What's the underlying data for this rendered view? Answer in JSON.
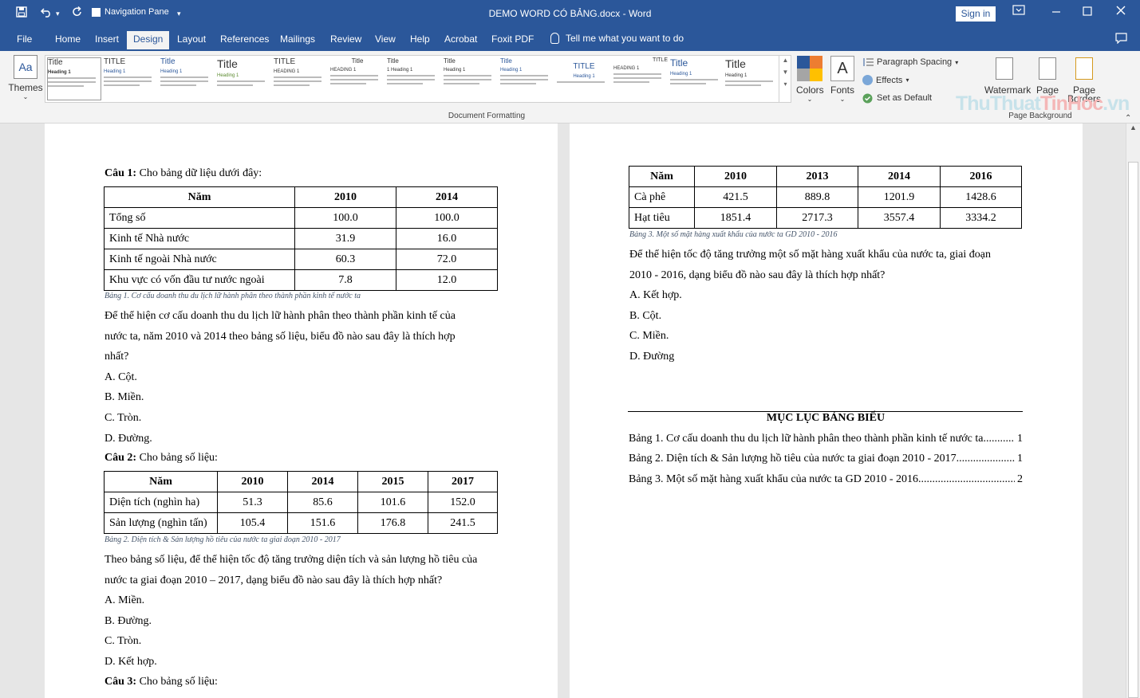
{
  "titlebar": {
    "nav_pane_label": "Navigation Pane",
    "document_title": "DEMO WORD CÓ BẢNG.docx  -  Word",
    "sign_in_label": "Sign in"
  },
  "menu": {
    "tabs": [
      "File",
      "Home",
      "Insert",
      "Design",
      "Layout",
      "References",
      "Mailings",
      "Review",
      "View",
      "Help",
      "Acrobat",
      "Foxit PDF"
    ],
    "active_tab": "Design",
    "tell_me": "Tell me what you want to do"
  },
  "ribbon": {
    "themes_label": "Themes",
    "style_thumbs": [
      {
        "title": "Title",
        "heading": "Heading 1"
      },
      {
        "title": "TITLE",
        "heading": "Heading 1"
      },
      {
        "title": "Title",
        "heading": "Heading 1"
      },
      {
        "title": "Title",
        "heading": "Heading 1"
      },
      {
        "title": "TITLE",
        "heading": "HEADING 1"
      },
      {
        "title": "Title",
        "heading": "HEADING 1"
      },
      {
        "title": "Title",
        "heading": "1  Heading 1"
      },
      {
        "title": "Title",
        "heading": "Heading 1"
      },
      {
        "title": "Title",
        "heading": "Heading 1"
      },
      {
        "title": "TITLE",
        "heading": "Heading 1"
      },
      {
        "title": "TITLE",
        "heading": "HEADING 1"
      },
      {
        "title": "Title",
        "heading": "Heading 1"
      },
      {
        "title": "Title",
        "heading": "Heading 1"
      }
    ],
    "colors_label": "Colors",
    "fonts_label": "Fonts",
    "paragraph_spacing_label": "Paragraph Spacing",
    "effects_label": "Effects",
    "set_default_label": "Set as Default",
    "watermark_label": "Watermark",
    "page_color_label": "Page",
    "page_borders_label": "Page",
    "page_borders_label2": "Borders",
    "group_document_formatting": "Document Formatting",
    "group_page_background": "Page Background",
    "watermark_logo": "ThuThuatTinHoc.vn"
  },
  "page1": {
    "q1_label": "Câu 1:",
    "q1_text": " Cho bảng dữ liệu dưới đây:",
    "table1": {
      "headers": [
        "Năm",
        "2010",
        "2014"
      ],
      "rows": [
        [
          "Tổng số",
          "100.0",
          "100.0"
        ],
        [
          "Kinh tế Nhà nước",
          "31.9",
          "16.0"
        ],
        [
          "Kinh tế ngoài Nhà nước",
          "60.3",
          "72.0"
        ],
        [
          "Khu vực có vốn đầu tư nước ngoài",
          "7.8",
          "12.0"
        ]
      ],
      "caption": "Bảng 1. Cơ cấu doanh thu du lịch lữ hành phân theo thành phần kinh tế nước ta"
    },
    "q1_para_1": "Để thể hiện cơ cấu doanh thu du lịch lữ hành phân theo thành phần kinh tế của",
    "q1_para_2": "nước ta, năm 2010 và 2014 theo bảng số liệu, biểu đồ nào sau đây là thích hợp",
    "q1_para_3": "nhất?",
    "q1_options": [
      "A. Cột.",
      "B. Miền.",
      "C. Tròn.",
      "D. Đường."
    ],
    "q2_label": "Câu 2:",
    "q2_text": " Cho bảng số liệu:",
    "table2": {
      "headers": [
        "Năm",
        "2010",
        "2014",
        "2015",
        "2017"
      ],
      "rows": [
        [
          "Diện tích (nghìn ha)",
          "51.3",
          "85.6",
          "101.6",
          "152.0"
        ],
        [
          "Sản lượng (nghìn tấn)",
          "105.4",
          "151.6",
          "176.8",
          "241.5"
        ]
      ],
      "caption": "Bảng 2. Diện tích & Sản lượng hồ tiêu của nước ta giai đoạn 2010 - 2017"
    },
    "q2_para_1": "Theo bảng số liệu, để thể hiện tốc độ tăng trưởng diện tích và sản lượng hồ tiêu của",
    "q2_para_2": "nước ta giai đoạn 2010 – 2017, dạng biểu đồ nào sau đây là thích hợp nhất?",
    "q2_options": [
      "A. Miền.",
      "B. Đường.",
      "C. Tròn.",
      "D. Kết hợp."
    ],
    "q3_label": "Câu 3:",
    "q3_text": " Cho bảng số liệu:"
  },
  "page2": {
    "table3": {
      "headers": [
        "Năm",
        "2010",
        "2013",
        "2014",
        "2016"
      ],
      "rows": [
        [
          "Cà phê",
          "421.5",
          "889.8",
          "1201.9",
          "1428.6"
        ],
        [
          "Hạt tiêu",
          "1851.4",
          "2717.3",
          "3557.4",
          "3334.2"
        ]
      ],
      "caption": "Bảng 3. Một số mặt hàng xuất khẩu của nước ta GD 2010 - 2016"
    },
    "q3_para_1": "Để thể hiện tốc độ tăng trưởng một số mặt hàng xuất khẩu của nước ta, giai đoạn",
    "q3_para_2": "2010 - 2016, dạng biểu đồ nào sau đây là thích hợp nhất?",
    "q3_options": [
      "A. Kết hợp.",
      "B. Cột.",
      "C. Miền.",
      "D. Đường"
    ],
    "toc_title": "MỤC LỤC BẢNG BIỂU",
    "toc": [
      {
        "label": "Bảng 1. Cơ cấu doanh thu du lịch lữ hành phân theo thành phần kinh tế nước ta",
        "page": "1"
      },
      {
        "label": "Bảng 2. Diện tích & Sản lượng hồ tiêu của nước ta giai đoạn 2010 - 2017 ",
        "page": "1"
      },
      {
        "label": "Bảng 3. Một số mặt hàng xuất khẩu của nước ta GD 2010 - 2016 ",
        "page": "2"
      }
    ]
  }
}
